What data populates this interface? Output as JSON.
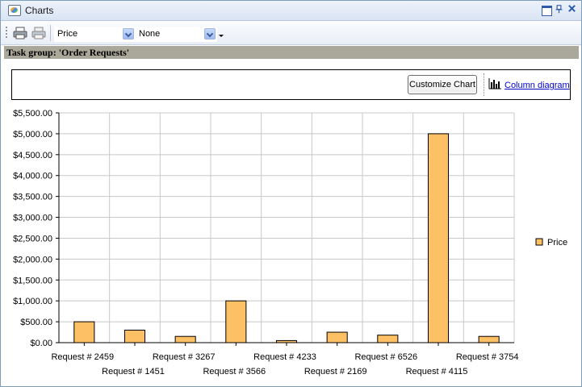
{
  "window": {
    "title": "Charts"
  },
  "toolbar": {
    "series_select": {
      "value": "Price"
    },
    "group_select": {
      "value": "None"
    }
  },
  "group_header": {
    "text": "Task group: 'Order Requests'"
  },
  "chart_panel": {
    "customize_label": "Customize Chart",
    "diagram_link": "Column diagram"
  },
  "chart_data": {
    "type": "bar",
    "categories": [
      "Request # 2459",
      "Request # 1451",
      "Request # 3267",
      "Request # 3566",
      "Request # 4233",
      "Request # 2169",
      "Request # 6526",
      "Request # 4115",
      "Request # 3754"
    ],
    "series": [
      {
        "name": "Price",
        "color": "#fdc064",
        "values": [
          500,
          300,
          150,
          1000,
          50,
          250,
          180,
          5000,
          150
        ]
      }
    ],
    "ylim": [
      0,
      5500
    ],
    "yticks": [
      "$0.00",
      "$500.00",
      "$1,000.00",
      "$1,500.00",
      "$2,000.00",
      "$2,500.00",
      "$3,000.00",
      "$3,500.00",
      "$4,000.00",
      "$4,500.00",
      "$5,000.00",
      "$5,500.00"
    ],
    "legend_position": "right",
    "grid": true
  }
}
